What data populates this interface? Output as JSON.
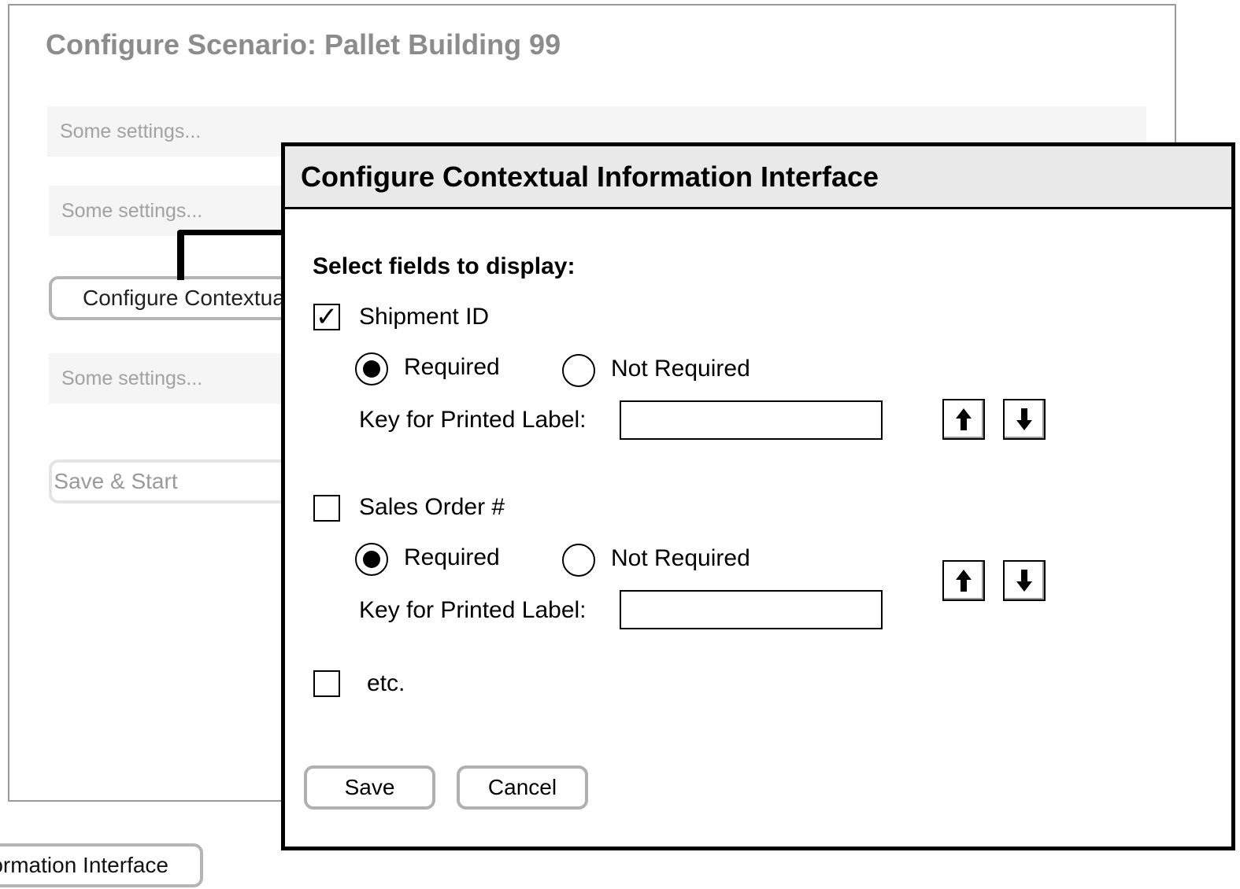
{
  "background": {
    "title": "Configure Scenario: Pallet Building 99",
    "settings": [
      "Some settings...",
      "Some settings...",
      "Some settings..."
    ],
    "configure_button_label": "Configure Contextual Information Interface",
    "save_start_label": "Save & Start",
    "bottom_tab_label": "Configure Contextual Information Interface"
  },
  "dialog": {
    "title": "Configure Contextual Information Interface",
    "select_label": "Select fields to display:",
    "fields": [
      {
        "label": "Shipment ID",
        "checked": true,
        "required_label": "Required",
        "not_required_label": "Not Required",
        "required": true,
        "key_label": "Key for Printed Label:",
        "key_value": ""
      },
      {
        "label": "Sales Order #",
        "checked": false,
        "required_label": "Required",
        "not_required_label": "Not Required",
        "required": true,
        "key_label": "Key for Printed Label:",
        "key_value": ""
      },
      {
        "label": "etc.",
        "checked": false
      }
    ],
    "save_label": "Save",
    "cancel_label": "Cancel",
    "checkmark": "✓",
    "icons": [
      "arrow-up-icon",
      "arrow-down-icon"
    ]
  }
}
